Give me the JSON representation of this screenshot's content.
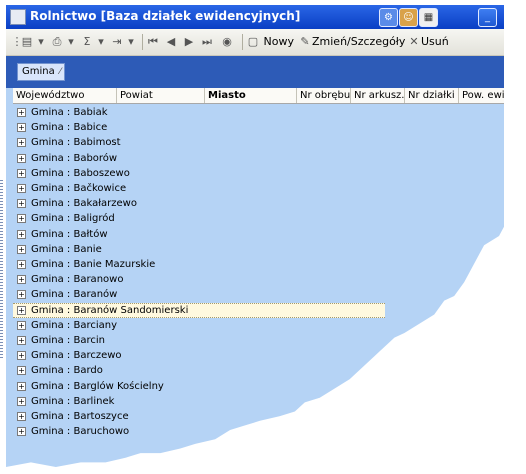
{
  "window": {
    "title": "Rolnictwo [Baza działek ewidencyjnych]"
  },
  "title_buttons": {
    "minimize": "_",
    "maximize": "□",
    "close": "✕"
  },
  "toolbar": {
    "new_label": "Nowy",
    "edit_label": "Zmień/Szczegóły",
    "delete_label": "Usuń"
  },
  "group_panel": {
    "chip_label": "Gmina"
  },
  "columns": [
    "Województwo",
    "Powiat",
    "Miasto",
    "Nr obrębu",
    "Nr arkusz...",
    "Nr działki",
    "Pow. ewid"
  ],
  "rows": [
    "Gmina : Babiak",
    "Gmina : Babice",
    "Gmina : Babimost",
    "Gmina : Baborów",
    "Gmina : Baboszewo",
    "Gmina : Bačkowice",
    "Gmina : Bakałarzewo",
    "Gmina : Baligród",
    "Gmina : Bałtów",
    "Gmina : Banie",
    "Gmina : Banie Mazurskie",
    "Gmina : Baranowo",
    "Gmina : Baranów",
    "Gmina : Baranów Sandomierski",
    "Gmina : Barciany",
    "Gmina : Barcin",
    "Gmina : Barczewo",
    "Gmina : Bardo",
    "Gmina : Barglów Kościelny",
    "Gmina : Barlinek",
    "Gmina : Bartoszyce",
    "Gmina : Baruchowo"
  ],
  "selected_row_index": 13,
  "colors": {
    "titlebar": "#0a3fc4",
    "grid_background": "#b5d3f5",
    "group_panel": "#2d5bb7",
    "selected_row": "#fff9df"
  }
}
